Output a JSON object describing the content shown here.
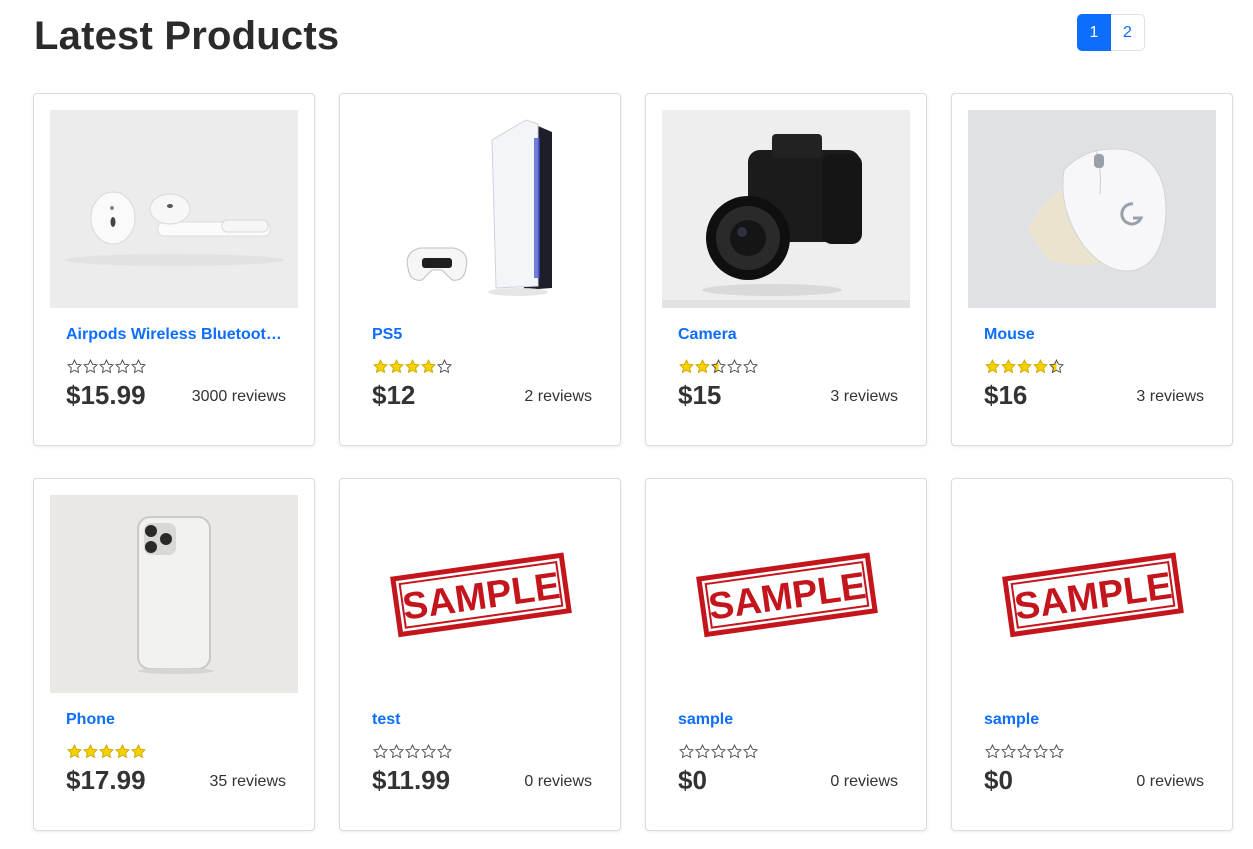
{
  "header": {
    "title": "Latest Products"
  },
  "pagination": {
    "pages": [
      "1",
      "2"
    ],
    "active": "1"
  },
  "colors": {
    "link": "#0d6efd",
    "star": "#f8d000",
    "sample_red": "#c4151c"
  },
  "products": [
    {
      "name": "Airpods Wireless Bluetooth Headphones",
      "rating": 0,
      "price": "$15.99",
      "reviews": "3000 reviews",
      "image": "airpods"
    },
    {
      "name": "PS5",
      "rating": 4,
      "price": "$12",
      "reviews": "2 reviews",
      "image": "ps5"
    },
    {
      "name": "Camera",
      "rating": 2.5,
      "price": "$15",
      "reviews": "3 reviews",
      "image": "camera"
    },
    {
      "name": "Mouse",
      "rating": 4.5,
      "price": "$16",
      "reviews": "3 reviews",
      "image": "mouse"
    },
    {
      "name": "Phone",
      "rating": 5,
      "price": "$17.99",
      "reviews": "35 reviews",
      "image": "phone"
    },
    {
      "name": "test",
      "rating": 0,
      "price": "$11.99",
      "reviews": "0 reviews",
      "image": "sample",
      "stamp_text": "SAMPLE"
    },
    {
      "name": "sample",
      "rating": 0,
      "price": "$0",
      "reviews": "0 reviews",
      "image": "sample",
      "stamp_text": "SAMPLE"
    },
    {
      "name": "sample",
      "rating": 0,
      "price": "$0",
      "reviews": "0 reviews",
      "image": "sample",
      "stamp_text": "SAMPLE"
    }
  ]
}
